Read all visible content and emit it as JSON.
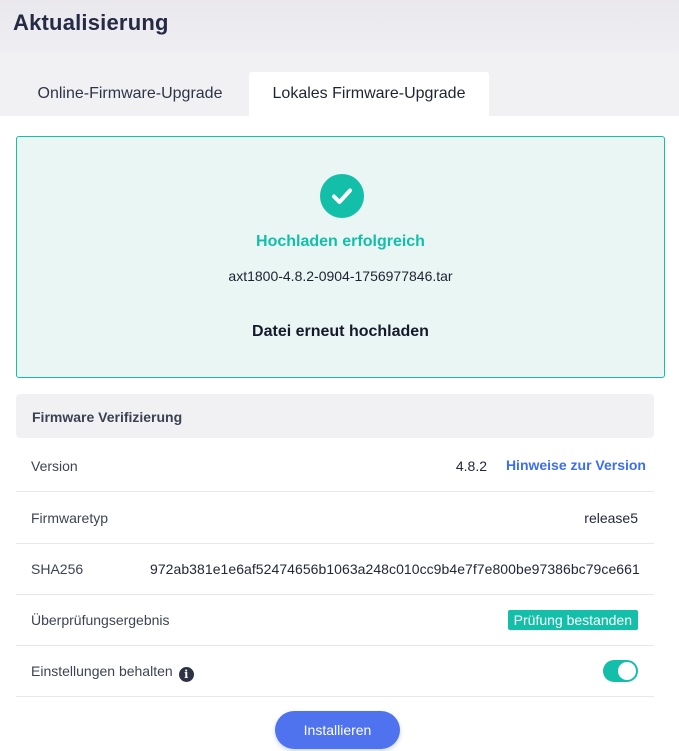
{
  "header": {
    "title": "Aktualisierung"
  },
  "tabs": [
    {
      "label": "Online-Firmware-Upgrade",
      "active": false
    },
    {
      "label": "Lokales Firmware-Upgrade",
      "active": true
    }
  ],
  "upload": {
    "status": "Hochladen erfolgreich",
    "filename": "axt1800-4.8.2-0904-1756977846.tar",
    "reupload_label": "Datei erneut hochladen",
    "icon": "check-circle-icon"
  },
  "verification": {
    "title": "Firmware Verifizierung",
    "version": {
      "label": "Version",
      "value": "4.8.2",
      "link": "Hinweise zur Version"
    },
    "type": {
      "label": "Firmwaretyp",
      "value": "release5"
    },
    "sha": {
      "label": "SHA256",
      "value": "972ab381e1e6af52474656b1063a248c010cc9b4e7f7e800be97386bc79ce661"
    },
    "result": {
      "label": "Überprüfungsergebnis",
      "value": "Prüfung bestanden"
    },
    "keep_settings": {
      "label": "Einstellungen behalten",
      "enabled": true,
      "info_icon": "info-icon"
    }
  },
  "install_label": "Installieren",
  "colors": {
    "accent": "#14bfa9",
    "primary": "#4f73ee",
    "link": "#3c6ef0"
  }
}
